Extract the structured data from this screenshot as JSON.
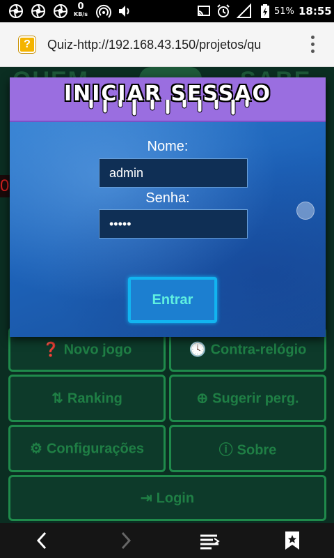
{
  "status_bar": {
    "net_speed_value": "0",
    "net_speed_unit": "KB/s",
    "battery_percent": "51%",
    "time": "18:55"
  },
  "browser": {
    "page_title_url": "Quiz-http://192.168.43.150/projetos/qu",
    "favicon_glyph": "?"
  },
  "background_page": {
    "red_number": "0",
    "tiles": {
      "novo_jogo": "Novo jogo",
      "contra_relogio": "Contra-relógio",
      "ranking": "Ranking",
      "sugerir": "Sugerir perg.",
      "configuracoes": "Configurações",
      "sobre": "Sobre",
      "login": "Login"
    },
    "accent_color": "#1f8a4b"
  },
  "login_modal": {
    "title": "INICIAR SESSAO",
    "name_label": "Nome:",
    "name_value": "admin",
    "password_label": "Senha:",
    "password_value": "•••••",
    "submit_label": "Entrar",
    "header_color": "#9a6ee0"
  }
}
